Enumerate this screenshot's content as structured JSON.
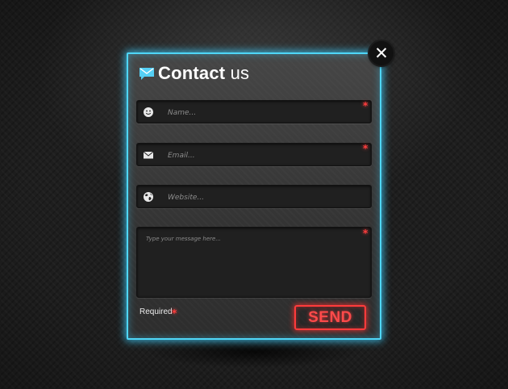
{
  "dialog": {
    "title_bold": "Contact",
    "title_rest": " us",
    "title_icon": "envelope-icon",
    "close_label": "✕",
    "close_icon": "close-icon"
  },
  "form": {
    "fields": [
      {
        "id": "name",
        "icon": "smiley-icon",
        "placeholder": "Name...",
        "value": "",
        "required": true
      },
      {
        "id": "email",
        "icon": "envelope-icon",
        "placeholder": "Email...",
        "value": "",
        "required": true
      },
      {
        "id": "website",
        "icon": "globe-icon",
        "placeholder": "Website...",
        "value": "",
        "required": false
      }
    ],
    "message": {
      "placeholder": "Type your message here...",
      "value": "",
      "required": true
    },
    "required_label": "Required",
    "required_marker": "*",
    "send_label": "SEND"
  },
  "colors": {
    "panel_glow": "#4fd6f7",
    "send_accent": "#ff3b3b",
    "required_star": "#ff3d3d",
    "background": "#1e1e1e"
  }
}
